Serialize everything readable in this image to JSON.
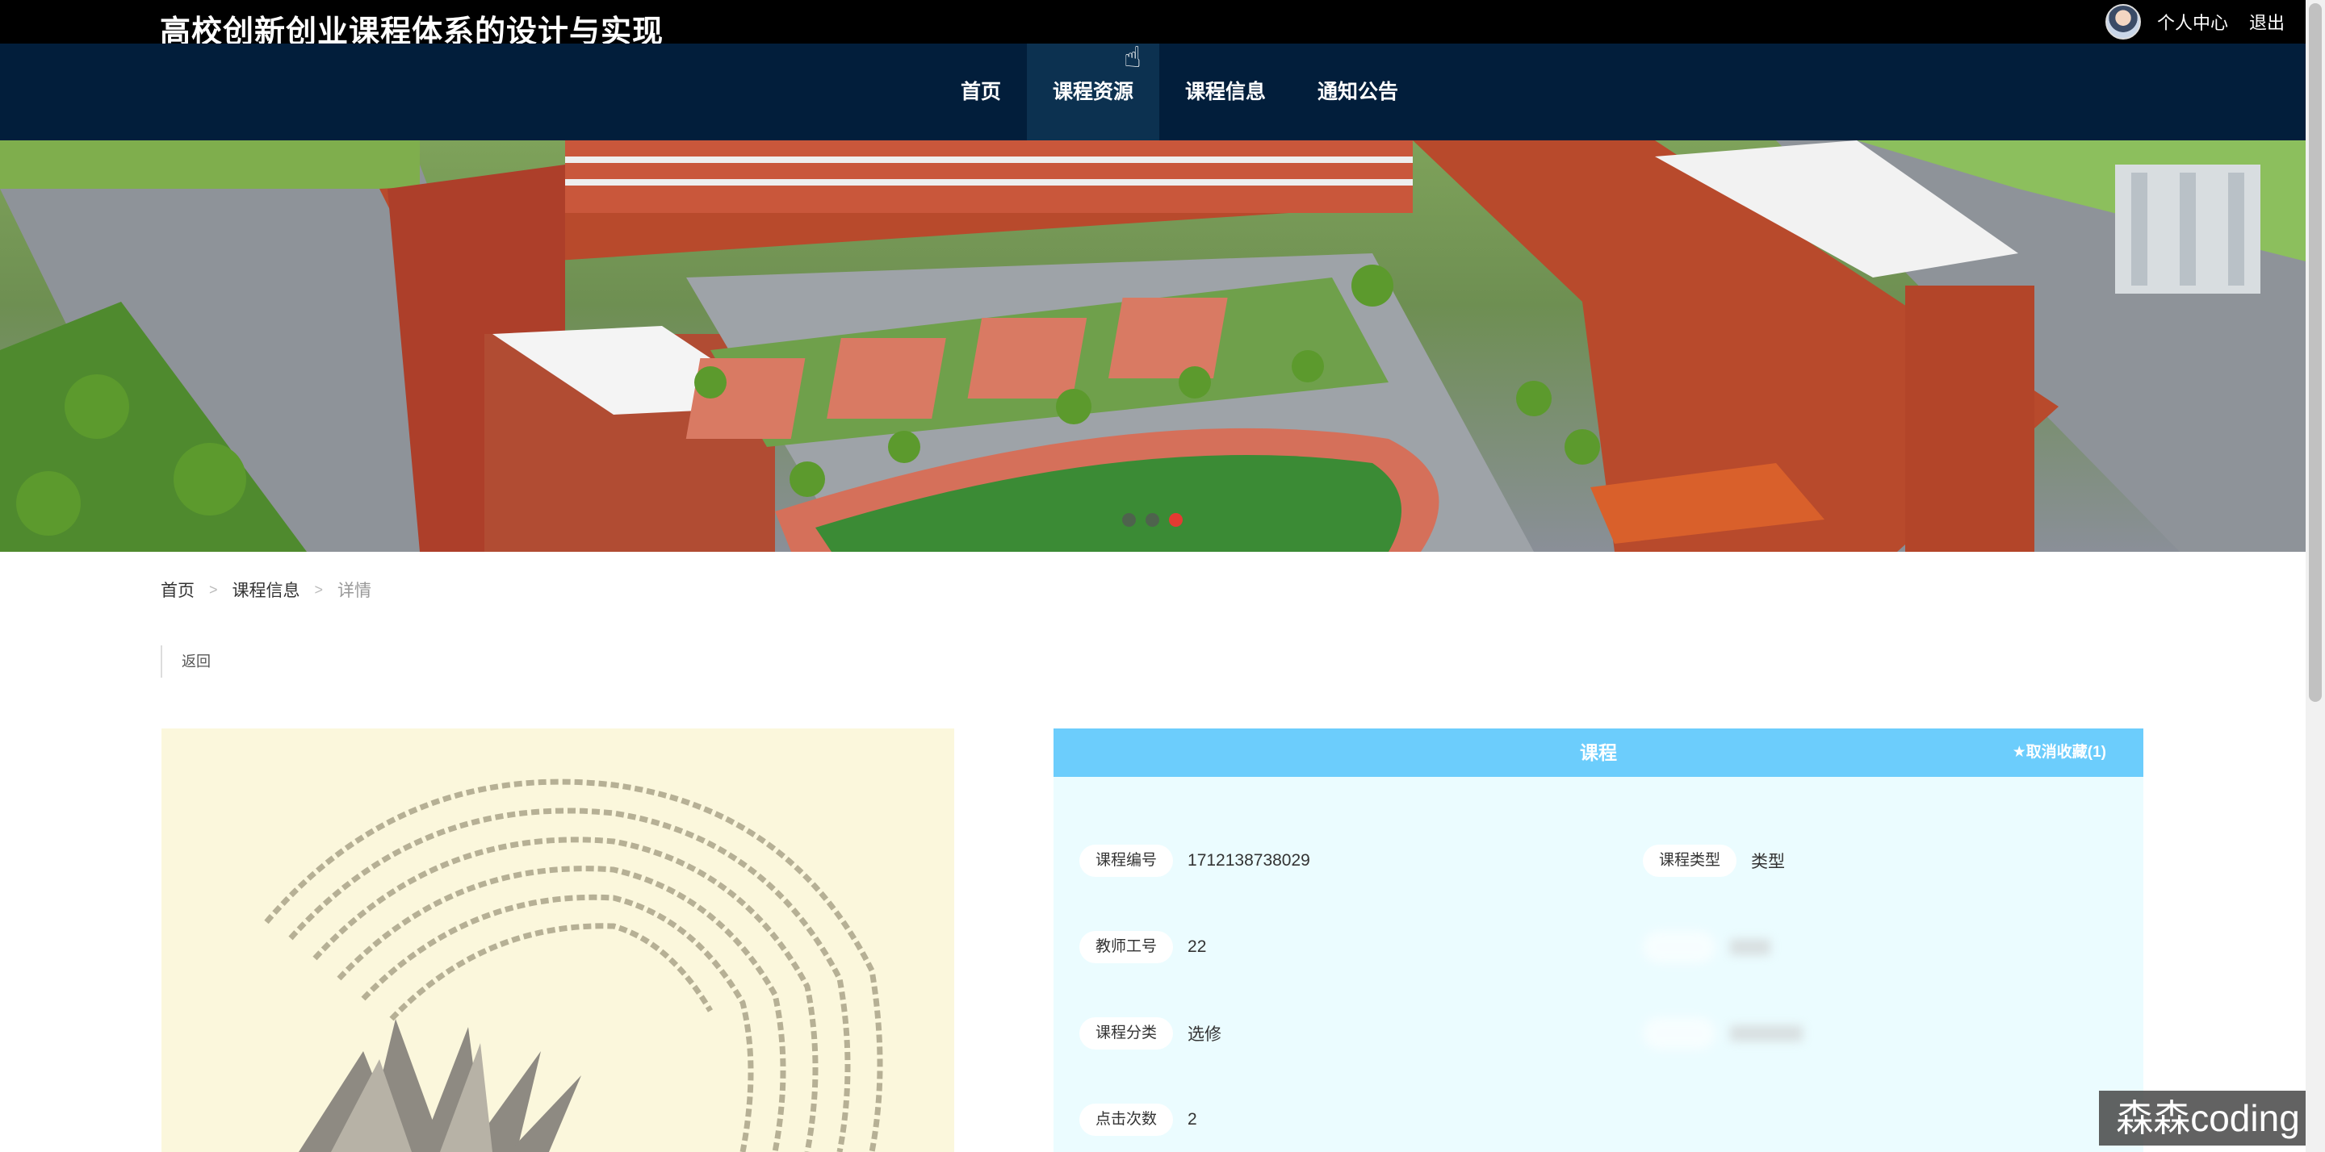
{
  "header": {
    "site_title": "高校创新创业课程体系的设计与实现",
    "user_center": "个人中心",
    "logout": "退出"
  },
  "nav": {
    "items": [
      {
        "label": "首页",
        "active": false
      },
      {
        "label": "课程资源",
        "active": true
      },
      {
        "label": "课程信息",
        "active": false
      },
      {
        "label": "通知公告",
        "active": false
      }
    ]
  },
  "banner": {
    "slide_count": 3,
    "active_slide": 3
  },
  "breadcrumb": {
    "home": "首页",
    "section": "课程信息",
    "current": "详情",
    "separator": ">"
  },
  "back_label": "返回",
  "detail": {
    "title": "课程",
    "favorite_label": "★取消收藏(1)",
    "fields": [
      {
        "label": "课程编号",
        "value": "1712138738029"
      },
      {
        "label": "课程类型",
        "value": "类型"
      },
      {
        "label": "教师工号",
        "value": "22"
      },
      {
        "label": "课程分类",
        "value": "选修"
      },
      {
        "label": "点击次数",
        "value": "2"
      }
    ]
  },
  "watermark": "森森coding",
  "colors": {
    "topbar": "#000000",
    "navbar": "#021e3b",
    "nav_active": "#0c3150",
    "detail_header": "#6ccdfc",
    "detail_body": "#ebfcff",
    "dot_active": "#e43a32"
  }
}
